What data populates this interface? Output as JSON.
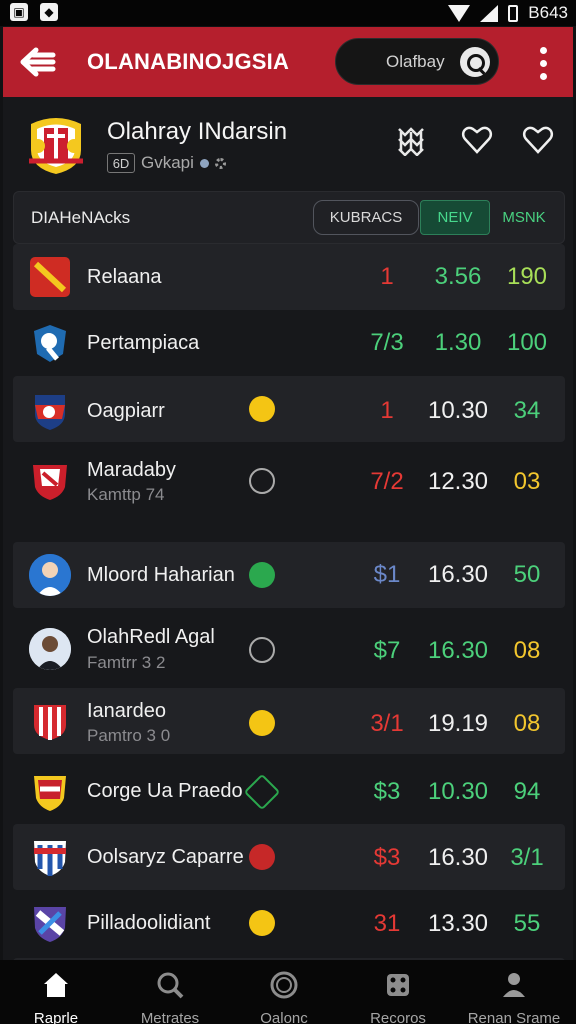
{
  "status_bar": {
    "clock": "B643"
  },
  "top_bar": {
    "title": "OLANABINOJGSIA",
    "search_placeholder": "Olafbay"
  },
  "team_header": {
    "name": "Olahray INdarsin",
    "badge_text": "6D",
    "meta_text": "Gvkapi"
  },
  "table_bar": {
    "label": "DIAHeNAcks",
    "segments": [
      "KUBRACS",
      "NEIV",
      "MSNK"
    ]
  },
  "rows": [
    {
      "name": "Relaana",
      "sub": "",
      "v1": "1",
      "v2": "3.56",
      "v3": "190"
    },
    {
      "name": "Pertampiaca",
      "sub": "",
      "v1": "7/3",
      "v2": "1.30",
      "v3": "100"
    },
    {
      "name": "Oagpiarr",
      "sub": "",
      "v1": "1",
      "v2": "10.30",
      "v3": "34"
    },
    {
      "name": "Maradaby",
      "sub": "Kamttp 74",
      "v1": "7/2",
      "v2": "12.30",
      "v3": "03"
    },
    {
      "name": "Mloord Haharian",
      "sub": "",
      "v1": "$1",
      "v2": "16.30",
      "v3": "50"
    },
    {
      "name": "OlahRedl Agal",
      "sub": "Famtrr 3 2",
      "v1": "$7",
      "v2": "16.30",
      "v3": "08"
    },
    {
      "name": "Ianardeo",
      "sub": "Pamtro 3 0",
      "v1": "3/1",
      "v2": "19.19",
      "v3": "08"
    },
    {
      "name": "Corge Ua Praedo",
      "sub": "",
      "v1": "$3",
      "v2": "10.30",
      "v3": "94"
    },
    {
      "name": "Oolsaryz Caparre",
      "sub": "",
      "v1": "$3",
      "v2": "16.30",
      "v3": "3/1"
    },
    {
      "name": "Pilladoolidiant",
      "sub": "",
      "v1": "31",
      "v2": "13.30",
      "v3": "55"
    }
  ],
  "bottom_nav": [
    {
      "label": "Raprle"
    },
    {
      "label": "Metrates"
    },
    {
      "label": "Oalonc"
    },
    {
      "label": "Recoros"
    },
    {
      "label": "Renan Srame"
    }
  ]
}
